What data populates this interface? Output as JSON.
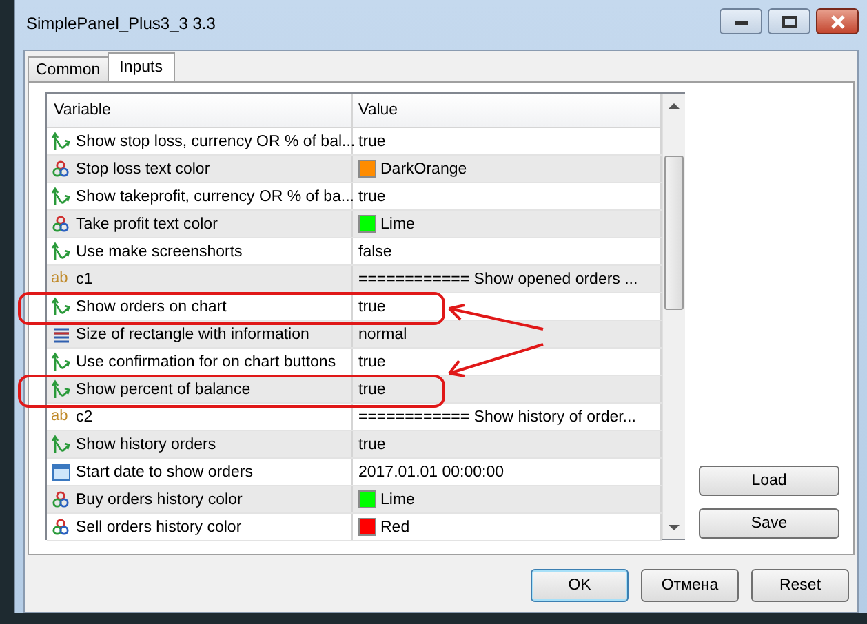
{
  "window": {
    "title": "SimplePanel_Plus3_3 3.3"
  },
  "tabs": [
    {
      "label": "Common",
      "selected": false
    },
    {
      "label": "Inputs",
      "selected": true
    }
  ],
  "table": {
    "columns": [
      "Variable",
      "Value"
    ],
    "rows": [
      {
        "kind": "bool",
        "variable": "Show stop loss, currency OR % of bal...",
        "value": "true",
        "highlighted": false
      },
      {
        "kind": "color",
        "variable": "Stop loss text color",
        "value": "DarkOrange",
        "color": "#ff8c00",
        "highlighted": false
      },
      {
        "kind": "bool",
        "variable": "Show takeprofit, currency OR % of ba...",
        "value": "true",
        "highlighted": false
      },
      {
        "kind": "color",
        "variable": "Take profit text color",
        "value": "Lime",
        "color": "#00ff00",
        "highlighted": false
      },
      {
        "kind": "bool",
        "variable": "Use make screenshorts",
        "value": "false",
        "highlighted": false
      },
      {
        "kind": "string",
        "icon": "ab",
        "variable": "c1",
        "value": "============ Show opened orders ...",
        "highlighted": false
      },
      {
        "kind": "bool",
        "variable": "Show orders on chart",
        "value": "true",
        "highlighted": true
      },
      {
        "kind": "enum",
        "variable": "Size of rectangle with information",
        "value": "normal",
        "highlighted": false
      },
      {
        "kind": "bool",
        "variable": "Use confirmation for on chart buttons",
        "value": "true",
        "highlighted": false
      },
      {
        "kind": "bool",
        "variable": "Show percent of balance",
        "value": "true",
        "highlighted": true
      },
      {
        "kind": "string",
        "icon": "ab",
        "variable": "c2",
        "value": "============ Show history of order...",
        "highlighted": false
      },
      {
        "kind": "bool",
        "variable": "Show history orders",
        "value": "true",
        "highlighted": false
      },
      {
        "kind": "date",
        "variable": "Start date to show orders",
        "value": "2017.01.01 00:00:00",
        "highlighted": false
      },
      {
        "kind": "color",
        "variable": "Buy orders history color",
        "value": "Lime",
        "color": "#00ff00",
        "highlighted": false
      },
      {
        "kind": "color",
        "variable": "Sell orders history color",
        "value": "Red",
        "color": "#ff0000",
        "highlighted": false
      }
    ]
  },
  "side_buttons": [
    "Load",
    "Save"
  ],
  "buttons": [
    {
      "label": "OK",
      "default": true
    },
    {
      "label": "Отмена",
      "default": false
    },
    {
      "label": "Reset",
      "default": false
    }
  ]
}
